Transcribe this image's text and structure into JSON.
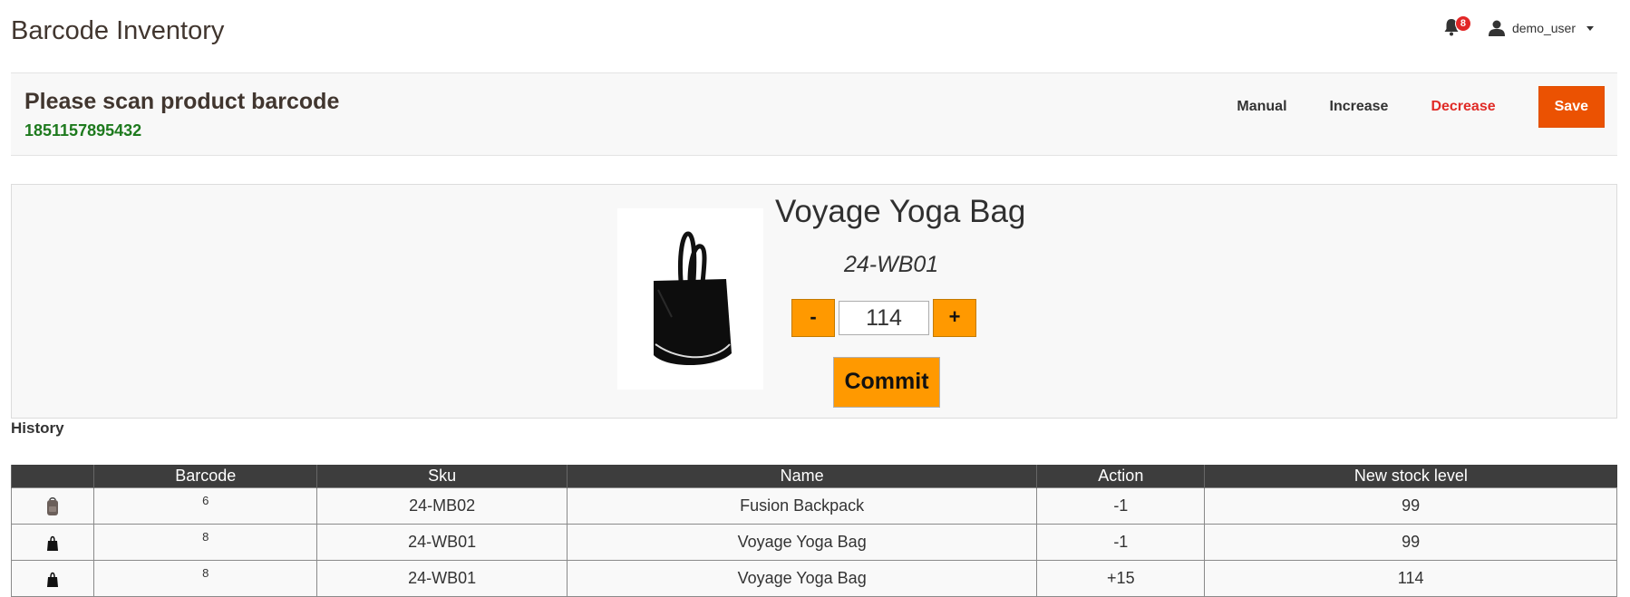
{
  "header": {
    "title": "Barcode Inventory",
    "notifications_count": "8",
    "username": "demo_user"
  },
  "scan": {
    "prompt": "Please scan product barcode",
    "last_barcode": "1851157895432",
    "actions": {
      "manual": "Manual",
      "increase": "Increase",
      "decrease": "Decrease",
      "save": "Save"
    }
  },
  "product": {
    "name": "Voyage Yoga Bag",
    "sku": "24-WB01",
    "quantity": "114",
    "minus_label": "-",
    "plus_label": "+",
    "commit_label": "Commit"
  },
  "history": {
    "label": "History",
    "columns": [
      "",
      "Barcode",
      "Sku",
      "Name",
      "Action",
      "New stock level"
    ],
    "rows": [
      {
        "image": "backpack-thumbnail",
        "barcode": "6",
        "sku": "24-MB02",
        "name": "Fusion Backpack",
        "action": "-1",
        "new_stock": "99"
      },
      {
        "image": "bag-thumbnail",
        "barcode": "8",
        "sku": "24-WB01",
        "name": "Voyage Yoga Bag",
        "action": "-1",
        "new_stock": "99"
      },
      {
        "image": "bag-thumbnail",
        "barcode": "8",
        "sku": "24-WB01",
        "name": "Voyage Yoga Bag",
        "action": "+15",
        "new_stock": "114"
      }
    ]
  },
  "colors": {
    "accent_orange": "#eb5202",
    "button_orange": "#ff9900",
    "decrease_red": "#e02b27",
    "barcode_green": "#1e7a1e",
    "table_header": "#3d3d3d"
  }
}
